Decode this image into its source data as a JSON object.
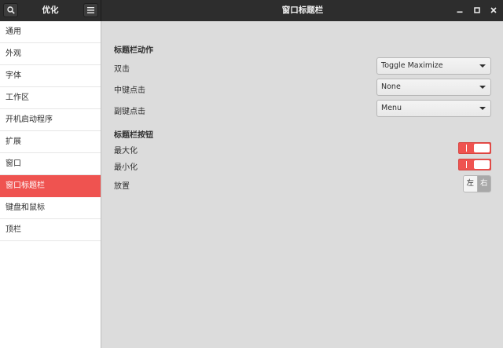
{
  "header": {
    "left_title": "优化",
    "main_title": "窗口标题栏"
  },
  "sidebar": {
    "items": [
      {
        "label": "通用"
      },
      {
        "label": "外观"
      },
      {
        "label": "字体"
      },
      {
        "label": "工作区"
      },
      {
        "label": "开机启动程序"
      },
      {
        "label": "扩展"
      },
      {
        "label": "窗口"
      },
      {
        "label": "窗口标题栏",
        "active": true
      },
      {
        "label": "键盘和鼠标"
      },
      {
        "label": "顶栏"
      }
    ]
  },
  "main": {
    "actions_section": {
      "title": "标题栏动作",
      "rows": [
        {
          "label": "双击",
          "value": "Toggle Maximize"
        },
        {
          "label": "中键点击",
          "value": "None"
        },
        {
          "label": "副键点击",
          "value": "Menu"
        }
      ]
    },
    "buttons_section": {
      "title": "标题栏按钮",
      "maximize": {
        "label": "最大化",
        "on": true
      },
      "minimize": {
        "label": "最小化",
        "on": true
      },
      "placement": {
        "label": "放置",
        "left": "左",
        "right": "右",
        "selected": "右"
      }
    }
  },
  "colors": {
    "accent": "#ef5350",
    "headerbar": "#2d2d2d",
    "background": "#dcdcdc"
  },
  "icons": {
    "search": "search-icon",
    "menu": "hamburger-menu-icon",
    "minimize": "minimize-icon",
    "maximize": "maximize-icon",
    "close": "close-icon"
  }
}
